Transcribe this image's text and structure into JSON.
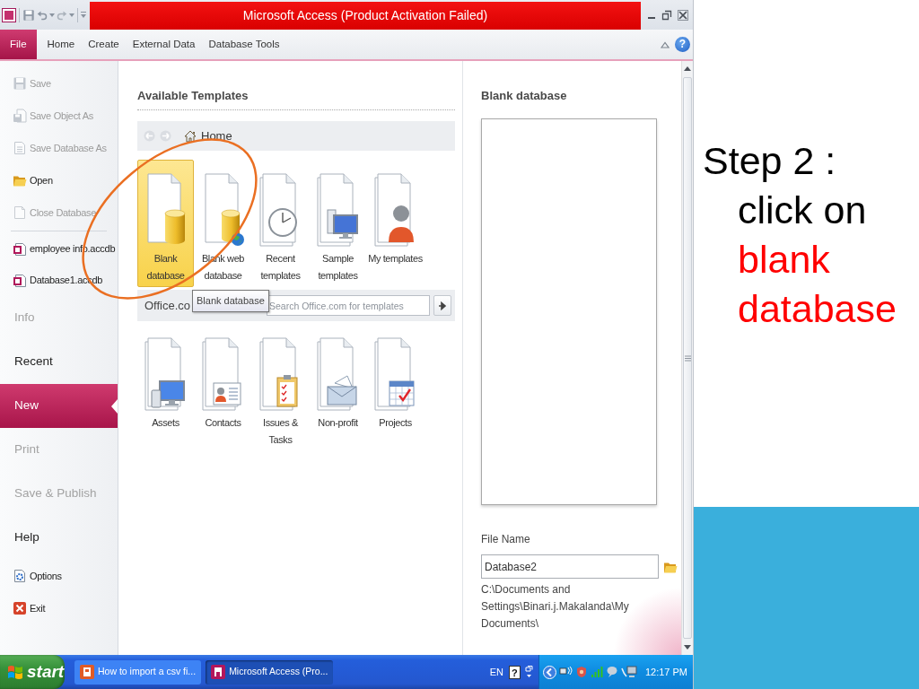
{
  "window": {
    "title": "Microsoft Access (Product Activation Failed)"
  },
  "ribbon": {
    "tabs": [
      {
        "label": "File",
        "selected": true
      },
      {
        "label": "Home",
        "selected": false
      },
      {
        "label": "Create",
        "selected": false
      },
      {
        "label": "External Data",
        "selected": false
      },
      {
        "label": "Database Tools",
        "selected": false
      }
    ],
    "help": "?"
  },
  "backstage": {
    "commands": [
      {
        "label": "Save",
        "disabled": true
      },
      {
        "label": "Save Object As",
        "disabled": true
      },
      {
        "label": "Save Database As",
        "disabled": true
      },
      {
        "label": "Open",
        "disabled": false
      },
      {
        "label": "Close Database",
        "disabled": true
      }
    ],
    "recent_files": [
      {
        "label": "employee info.accdb"
      },
      {
        "label": "Database1.accdb"
      }
    ],
    "tabs": [
      {
        "label": "Info",
        "selected": false,
        "disabled": true
      },
      {
        "label": "Recent",
        "selected": false,
        "disabled": false
      },
      {
        "label": "New",
        "selected": true,
        "disabled": false
      },
      {
        "label": "Print",
        "selected": false,
        "disabled": true
      },
      {
        "label": "Save & Publish",
        "selected": false,
        "disabled": true
      },
      {
        "label": "Help",
        "selected": false,
        "disabled": false
      }
    ],
    "footer_commands": [
      {
        "label": "Options"
      },
      {
        "label": "Exit"
      }
    ]
  },
  "templates": {
    "title": "Available Templates",
    "breadcrumb": "Home",
    "tiles": [
      {
        "label": "Blank database",
        "selected": true
      },
      {
        "label": "Blank web database",
        "selected": false
      },
      {
        "label": "Recent templates",
        "selected": false
      },
      {
        "label": "Sample templates",
        "selected": false
      },
      {
        "label": "My templates",
        "selected": false
      }
    ],
    "tooltip": "Blank database",
    "office_section": "Office.co",
    "search": {
      "placeholder": "Search Office.com for templates"
    },
    "office_tiles": [
      {
        "label": "Assets",
        "selected": false
      },
      {
        "label": "Contacts",
        "selected": false
      },
      {
        "label": "Issues & Tasks",
        "selected": false
      },
      {
        "label": "Non-profit",
        "selected": false
      },
      {
        "label": "Projects",
        "selected": false
      }
    ]
  },
  "details": {
    "title": "Blank database",
    "file_name_label": "File Name",
    "file_name": "Database2",
    "path": "C:\\Documents and Settings\\Binari.j.Makalanda\\My Documents\\"
  },
  "taskbar": {
    "start": "start",
    "tasks": [
      {
        "label": "How to import a csv fi...",
        "selected": false
      },
      {
        "label": "Microsoft Access (Pro...",
        "selected": true
      }
    ],
    "language": "EN",
    "help": "?",
    "clock": "12:17 PM"
  },
  "slide": {
    "lines": [
      {
        "text": "Step 2 :",
        "kind": "heading",
        "color": "#000000"
      },
      {
        "text": "click on",
        "kind": "body",
        "color": "#000000"
      },
      {
        "text": "blank",
        "kind": "body",
        "color": "#ff0000"
      },
      {
        "text": "database",
        "kind": "body",
        "color": "#ff0000"
      }
    ]
  }
}
